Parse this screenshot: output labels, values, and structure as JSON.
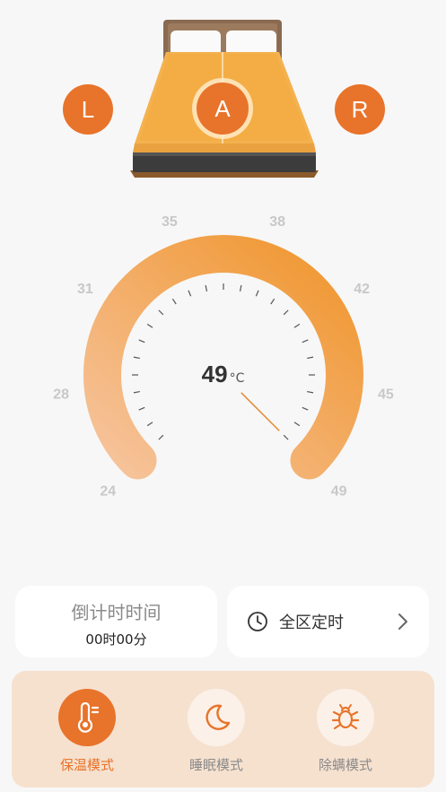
{
  "zones": {
    "left_label": "L",
    "all_label": "A",
    "right_label": "R"
  },
  "gauge": {
    "tick_labels": [
      "24",
      "28",
      "31",
      "35",
      "38",
      "42",
      "45",
      "49"
    ],
    "current_temp": "49",
    "unit": "°C",
    "min": 24,
    "max": 49,
    "value": 49,
    "accent_color": "#e8732a",
    "gradient_start": "#f6c39b",
    "gradient_end": "#f0962e"
  },
  "countdown": {
    "label": "倒计时时间",
    "value": "00时00分"
  },
  "timer": {
    "label": "全区定时",
    "icon": "clock-icon",
    "arrow_icon": "chevron-right-icon"
  },
  "modes": [
    {
      "label": "保温模式",
      "icon": "thermometer-icon",
      "active": true
    },
    {
      "label": "睡眠模式",
      "icon": "moon-icon",
      "active": false
    },
    {
      "label": "除螨模式",
      "icon": "bug-icon",
      "active": false
    }
  ]
}
